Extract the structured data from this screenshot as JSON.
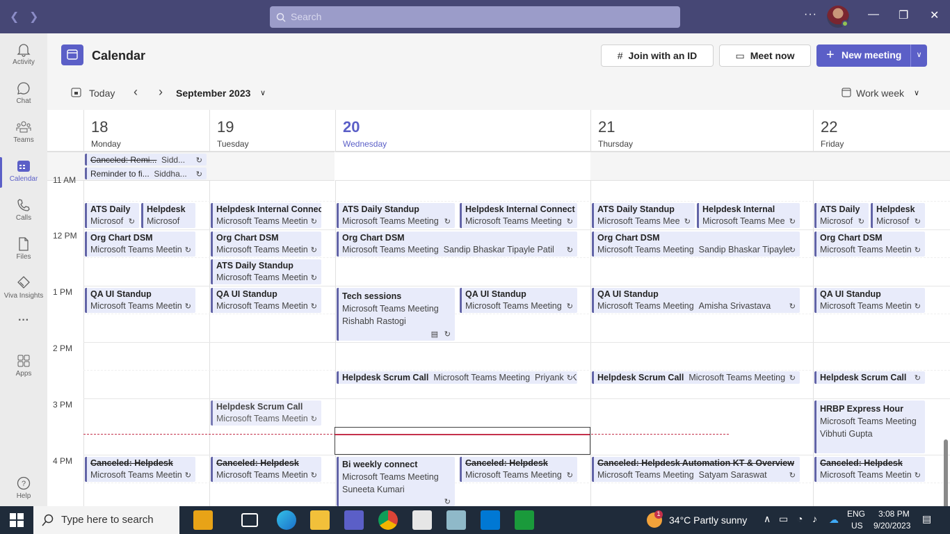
{
  "titlebar": {
    "search_placeholder": "Search",
    "more": "···"
  },
  "rail": [
    {
      "label": "Activity",
      "icon": "bell-icon"
    },
    {
      "label": "Chat",
      "icon": "chat-icon"
    },
    {
      "label": "Teams",
      "icon": "teams-icon"
    },
    {
      "label": "Calendar",
      "icon": "calendar-icon"
    },
    {
      "label": "Calls",
      "icon": "phone-icon"
    },
    {
      "label": "Files",
      "icon": "file-icon"
    },
    {
      "label": "Viva Insights",
      "icon": "viva-insights-icon"
    },
    {
      "label": "···",
      "icon": "more-icon"
    },
    {
      "label": "Apps",
      "icon": "apps-icon"
    },
    {
      "label": "Help",
      "icon": "help-icon"
    }
  ],
  "header": {
    "title": "Calendar",
    "join": "Join with an ID",
    "meet": "Meet now",
    "new": "New meeting"
  },
  "subbar": {
    "today": "Today",
    "month": "September 2023",
    "view": "Work week"
  },
  "days": [
    {
      "num": "18",
      "name": "Monday"
    },
    {
      "num": "19",
      "name": "Tuesday"
    },
    {
      "num": "20",
      "name": "Wednesday"
    },
    {
      "num": "21",
      "name": "Thursday"
    },
    {
      "num": "22",
      "name": "Friday"
    }
  ],
  "times": [
    "11 AM",
    "12 PM",
    "1 PM",
    "2 PM",
    "3 PM",
    "4 PM"
  ],
  "allday": {
    "e1": {
      "t": "Canceled: Remi...",
      "s": "Sidd..."
    },
    "e2": {
      "t": "Reminder to fi...",
      "s": "Siddha..."
    }
  },
  "events": {
    "mon_ats": {
      "t": "ATS Daily",
      "s": "Microsof"
    },
    "mon_help": {
      "t": "Helpdesk",
      "s": "Microsof"
    },
    "mon_org": {
      "t": "Org Chart DSM",
      "s": "Microsoft Teams Meetin"
    },
    "mon_qa": {
      "t": "QA UI Standup",
      "s": "Microsoft Teams Meetin"
    },
    "mon_cx": {
      "t": "Canceled: Helpdesk",
      "s": "Microsoft Teams Meetin"
    },
    "tue_help": {
      "t": "Helpdesk Internal Connect",
      "s": "Microsoft Teams Meetin"
    },
    "tue_org": {
      "t": "Org Chart DSM",
      "s": "Microsoft Teams Meetin"
    },
    "tue_ats": {
      "t": "ATS Daily Standup",
      "s": "Microsoft Teams Meetin"
    },
    "tue_qa": {
      "t": "QA UI Standup",
      "s": "Microsoft Teams Meetin"
    },
    "tue_scrum": {
      "t": "Helpdesk Scrum Call",
      "s": "Microsoft Teams Meetin"
    },
    "tue_cx": {
      "t": "Canceled: Helpdesk",
      "s": "Microsoft Teams Meetin"
    },
    "wed_ats": {
      "t": "ATS Daily Standup",
      "s": "Microsoft Teams Meeting"
    },
    "wed_help": {
      "t": "Helpdesk Internal Connect",
      "s": "Microsoft Teams Meeting"
    },
    "wed_org": {
      "t": "Org Chart DSM",
      "s": "Microsoft Teams Meeting",
      "o": "Sandip Bhaskar Tipayle Patil"
    },
    "wed_tech": {
      "t": "Tech sessions",
      "s": "Microsoft Teams Meeting",
      "o": "Rishabh Rastogi"
    },
    "wed_qa": {
      "t": "QA UI Standup",
      "s": "Microsoft Teams Meeting"
    },
    "wed_scrum": {
      "t": "Helpdesk Scrum Call",
      "s": "Microsoft Teams Meeting",
      "o": "Priyanka Ki"
    },
    "wed_bi": {
      "t": "Bi weekly connect",
      "s": "Microsoft Teams Meeting",
      "o": "Suneeta Kumari"
    },
    "wed_cx": {
      "t": "Canceled: Helpdesk",
      "s": "Microsoft Teams Meeting"
    },
    "thu_ats": {
      "t": "ATS Daily Standup",
      "s": "Microsoft Teams Mee"
    },
    "thu_help": {
      "t": "Helpdesk Internal",
      "s": "Microsoft Teams Mee"
    },
    "thu_org": {
      "t": "Org Chart DSM",
      "s": "Microsoft Teams Meeting",
      "o": "Sandip Bhaskar Tipayle"
    },
    "thu_qa": {
      "t": "QA UI Standup",
      "s": "Microsoft Teams Meeting",
      "o": "Amisha Srivastava"
    },
    "thu_scrum": {
      "t": "Helpdesk Scrum Call",
      "s": "Microsoft Teams Meeting",
      "o": "P"
    },
    "thu_cx": {
      "t": "Canceled: Helpdesk Automation KT & Overview",
      "s": "Microsoft Teams Meeting",
      "o": "Satyam Saraswat"
    },
    "fri_ats": {
      "t": "ATS Daily",
      "s": "Microsof"
    },
    "fri_help": {
      "t": "Helpdesk",
      "s": "Microsof"
    },
    "fri_org": {
      "t": "Org Chart DSM",
      "s": "Microsoft Teams Meetin"
    },
    "fri_qa": {
      "t": "QA UI Standup",
      "s": "Microsoft Teams Meetin"
    },
    "fri_scrum": {
      "t": "Helpdesk Scrum Call",
      "s": "M"
    },
    "fri_hrbp": {
      "t": "HRBP Express Hour",
      "s": "Microsoft Teams Meeting",
      "o": "Vibhuti Gupta"
    },
    "fri_cx": {
      "t": "Canceled: Helpdesk",
      "s": "Microsoft Teams Meetin"
    }
  },
  "taskbar": {
    "search": "Type here to search",
    "weather": "34°C  Partly sunny",
    "lang1": "ENG",
    "lang2": "US",
    "time": "3:08 PM",
    "date": "9/20/2023",
    "notif": "1"
  },
  "colors": {
    "brand": "#5b5fc7",
    "titlebar": "#464775",
    "now": "#c4314b"
  }
}
